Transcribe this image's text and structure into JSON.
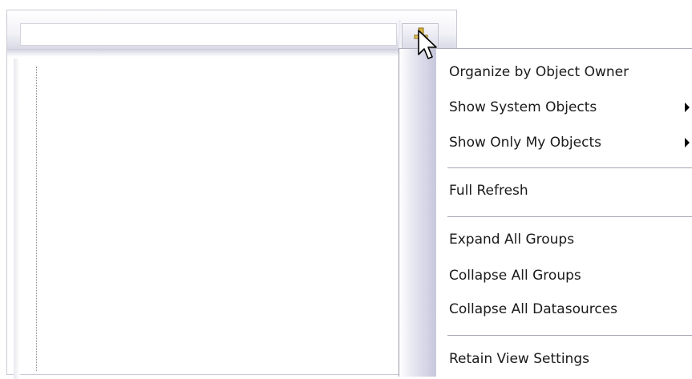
{
  "menu": {
    "items": [
      {
        "label": "Organize by Object Owner",
        "submenu": false
      },
      {
        "label": "Show System Objects",
        "submenu": true
      },
      {
        "label": "Show Only My Objects",
        "submenu": true
      },
      {
        "label": "Full Refresh",
        "submenu": false
      },
      {
        "label": "Expand All Groups",
        "submenu": false
      },
      {
        "label": "Collapse All Groups",
        "submenu": false
      },
      {
        "label": "Collapse All Datasources",
        "submenu": false
      },
      {
        "label": "Retain View Settings",
        "submenu": false
      }
    ]
  },
  "icons": {
    "pin": "pin-icon",
    "cursor": "mouse-pointer-icon",
    "submenu_arrow": "submenu-arrow-icon"
  },
  "colors": {
    "menu_gutter": "#c7c7dc",
    "separator": "#a5a5b3",
    "pin_gold": "#d8b443"
  }
}
